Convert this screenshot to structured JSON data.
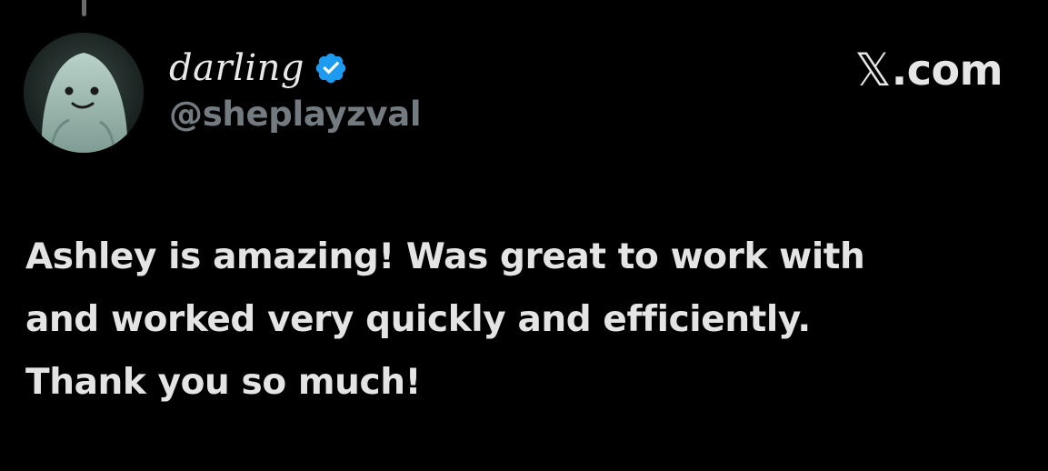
{
  "author": {
    "display_name": "darling",
    "handle": "@sheplayzval",
    "verified": true,
    "verified_icon": "verified-badge-icon",
    "avatar": "ghost-avatar"
  },
  "brand": {
    "logo_icon": "x-logo-icon",
    "logo_glyph": "𝕏",
    "text": ".com"
  },
  "tweet": {
    "lines": [
      "Ashley is amazing! Was great to work with",
      "and worked very quickly and efficiently.",
      "Thank you so much!"
    ]
  },
  "colors": {
    "background": "#000000",
    "text": "#e4e4e4",
    "handle": "#747b80",
    "verified": "#1d9bf0"
  }
}
